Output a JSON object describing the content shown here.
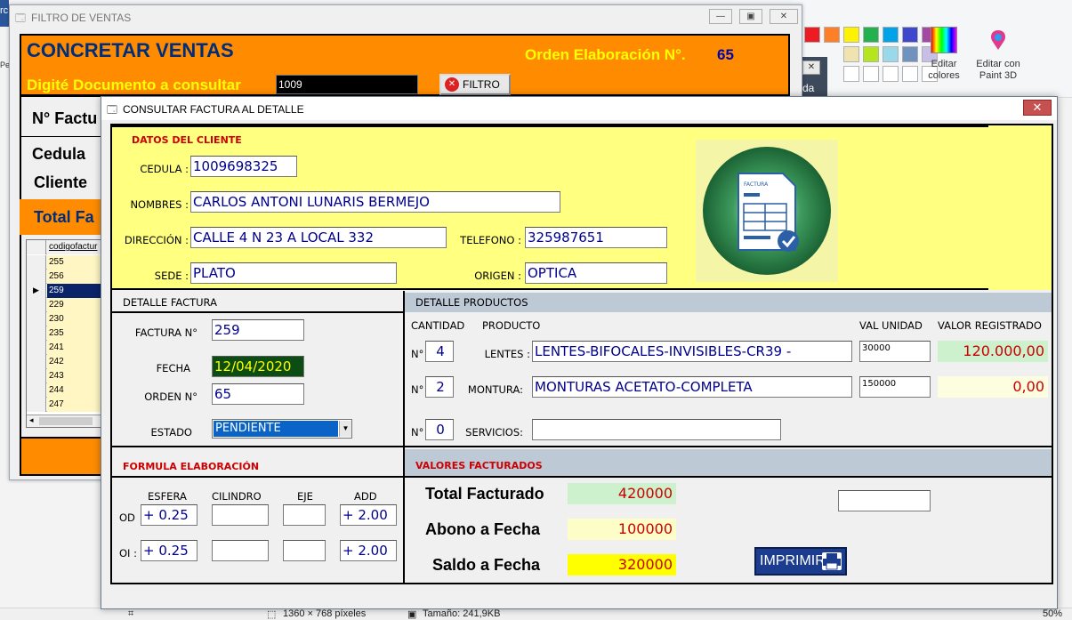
{
  "paint": {
    "edit_colors_1": "Editar",
    "edit_colors_2": "colores",
    "paint3d_1": "Editar con",
    "paint3d_2": "Paint 3D",
    "side_da": "da",
    "status_dims": "1360 × 768 píxeles",
    "status_size": "Tamaño: 241,9KB",
    "status_zoom": "50%",
    "left_fragment": "rc",
    "left_small": "Pe"
  },
  "back_window": {
    "title": "FILTRO DE VENTAS",
    "heading": "CONCRETAR VENTAS",
    "orden_label": "Orden Elaboración N°.",
    "orden_value": "65",
    "digite_label": "Digité Documento a consultar",
    "doc_value": "1009",
    "filtro_btn": "FILTRO",
    "factura_label": "N° Factu",
    "cedula_label": "Cedula",
    "cliente_label": "Cliente",
    "total_label": "Total Fa",
    "grid_header": "codigofactur",
    "grid_rows": [
      "255",
      "256",
      "259",
      "229",
      "230",
      "235",
      "241",
      "242",
      "243",
      "244",
      "247"
    ]
  },
  "front_window": {
    "title": "CONSULTAR FACTURA AL DETALLE",
    "datos_cliente": "DATOS DEL CLIENTE",
    "cedula_label": "CEDULA :",
    "cedula_value": "1009698325",
    "nombres_label": "NOMBRES :",
    "nombres_value": "CARLOS ANTONI LUNARIS BERMEJO",
    "direccion_label": "DIRECCIÓN :",
    "direccion_value": "CALLE 4 N 23 A LOCAL 332",
    "telefono_label": "TELEFONO :",
    "telefono_value": "325987651",
    "sede_label": "SEDE :",
    "sede_value": "PLATO",
    "origen_label": "ORIGEN :",
    "origen_value": "OPTICA",
    "logo_text": "FACTURA",
    "detalle_factura": "DETALLE FACTURA",
    "factura_n_label": "FACTURA  N°",
    "factura_n_value": "259",
    "fecha_label": "FECHA",
    "fecha_value": "12/04/2020",
    "orden_label": "ORDEN N°",
    "orden_value": "65",
    "estado_label": "ESTADO",
    "estado_value": "PENDIENTE",
    "detalle_productos": "DETALLE PRODUCTOS",
    "col_cantidad": "CANTIDAD",
    "col_producto": "PRODUCTO",
    "col_val_unidad": "VAL UNIDAD",
    "col_valor_registrado": "VALOR REGISTRADO",
    "products": [
      {
        "n": "N°",
        "qty": "4",
        "label": "LENTES :",
        "name": "LENTES-BIFOCALES-INVISIBLES-CR39  -",
        "unit": "30000",
        "total": "120.000,00"
      },
      {
        "n": "N°",
        "qty": "2",
        "label": "MONTURA:",
        "name": "MONTURAS  ACETATO-COMPLETA",
        "unit": "150000",
        "total": "0,00"
      },
      {
        "n": "N°",
        "qty": "0",
        "label": "SERVICIOS:",
        "name": "",
        "unit": "",
        "total": ""
      }
    ],
    "formula": "FORMULA ELABORACIÓN",
    "col_esfera": "ESFERA",
    "col_cilindro": "CILINDRO",
    "col_eje": "EJE",
    "col_add": "ADD",
    "od_label": "OD",
    "od_esfera": "+ 0.25",
    "od_add": "+  2.00",
    "oi_label": "OI :",
    "oi_esfera": "+ 0.25",
    "oi_add": "+  2.00",
    "valores": "VALORES FACTURADOS",
    "total_label": "Total Facturado",
    "total_value": "420000",
    "abono_label": "Abono a Fecha",
    "abono_value": "100000",
    "saldo_label": "Saldo a Fecha",
    "saldo_value": "320000",
    "imprimir": "IMPRIMIR"
  }
}
